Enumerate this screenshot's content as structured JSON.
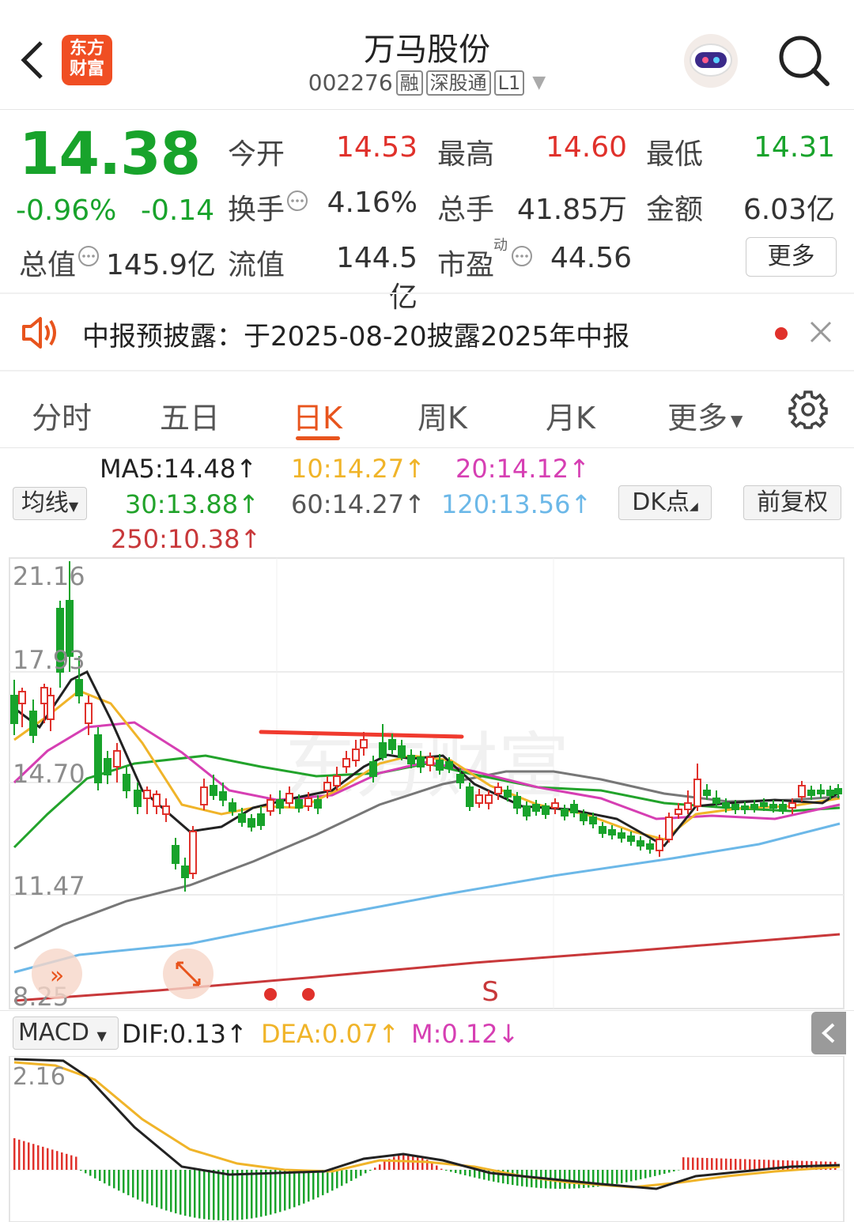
{
  "header": {
    "title": "万马股份",
    "code": "002276",
    "tags": [
      "融",
      "深股通",
      "L1"
    ],
    "logo_text_line1": "东方",
    "logo_text_line2": "财富"
  },
  "quote": {
    "price": "14.38",
    "change_pct": "-0.96%",
    "change": "-0.14",
    "open_label": "今开",
    "open": "14.53",
    "high_label": "最高",
    "high": "14.60",
    "low_label": "最低",
    "low": "14.31",
    "turnover_label": "换手",
    "turnover": "4.16%",
    "volume_label": "总手",
    "volume": "41.85万",
    "amount_label": "金额",
    "amount": "6.03亿",
    "mktcap_label": "总值",
    "mktcap": "145.9亿",
    "float_label": "流值",
    "float": "144.5亿",
    "pe_label": "市盈",
    "pe_sup": "动",
    "pe": "44.56",
    "more_label": "更多"
  },
  "notice": {
    "text": "中报预披露：于2025-08-20披露2025年中报"
  },
  "tabs": [
    {
      "label": "分时"
    },
    {
      "label": "五日"
    },
    {
      "label": "日K"
    },
    {
      "label": "周K"
    },
    {
      "label": "月K"
    },
    {
      "label": "更多"
    }
  ],
  "ma_bar": {
    "selector": "均线",
    "ma5": "MA5:14.48↑",
    "ma10": "10:14.27↑",
    "ma20": "20:14.12↑",
    "ma30": "30:13.88↑",
    "ma60": "60:14.27↑",
    "ma120": "120:13.56↑",
    "ma250": "250:10.38↑",
    "dk_label": "DK点",
    "adjust_label": "前复权"
  },
  "kline": {
    "y_labels": [
      "21.16",
      "17.93",
      "14.70",
      "11.47",
      "8.25"
    ],
    "signal_s": "S",
    "colors": {
      "up": "#e0312b",
      "down": "#18a32b",
      "ma5": "#222222",
      "ma10": "#f0b429",
      "ma20": "#d63fb3",
      "ma30": "#22a32b",
      "ma60": "#777777",
      "ma120": "#6cb8e8",
      "ma250": "#c8383a"
    }
  },
  "macd": {
    "selector": "MACD",
    "dif": "DIF:0.13↑",
    "dea": "DEA:0.07↑",
    "m": "M:0.12↓",
    "y_label_top": "2.16"
  }
}
